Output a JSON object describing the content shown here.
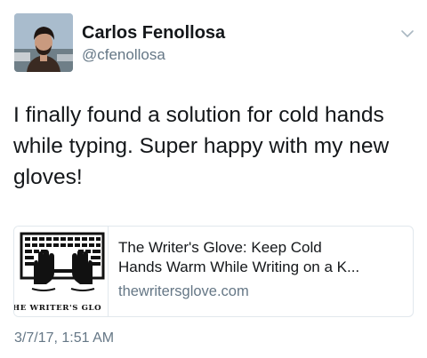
{
  "author": {
    "display_name": "Carlos Fenollosa",
    "handle": "@cfenollosa",
    "avatar_icon": "avatar-photo"
  },
  "menu_icon": "chevron-down-icon",
  "tweet": {
    "text_lines": [
      "I finally found a solution for cold hands",
      "while typing. Super happy with my new",
      "gloves!"
    ]
  },
  "link_card": {
    "title_lines": [
      "The Writer's Glove: Keep Cold",
      "Hands Warm While Writing on a K..."
    ],
    "domain": "thewritersglove.com",
    "image_caption": "HE WRITER'S GLO",
    "image_icon": "keyboard-gloves-logo"
  },
  "timestamp": "3/7/17, 1:51 AM",
  "colors": {
    "text": "#14171a",
    "secondary": "#657786",
    "border": "#e1e8ed"
  }
}
